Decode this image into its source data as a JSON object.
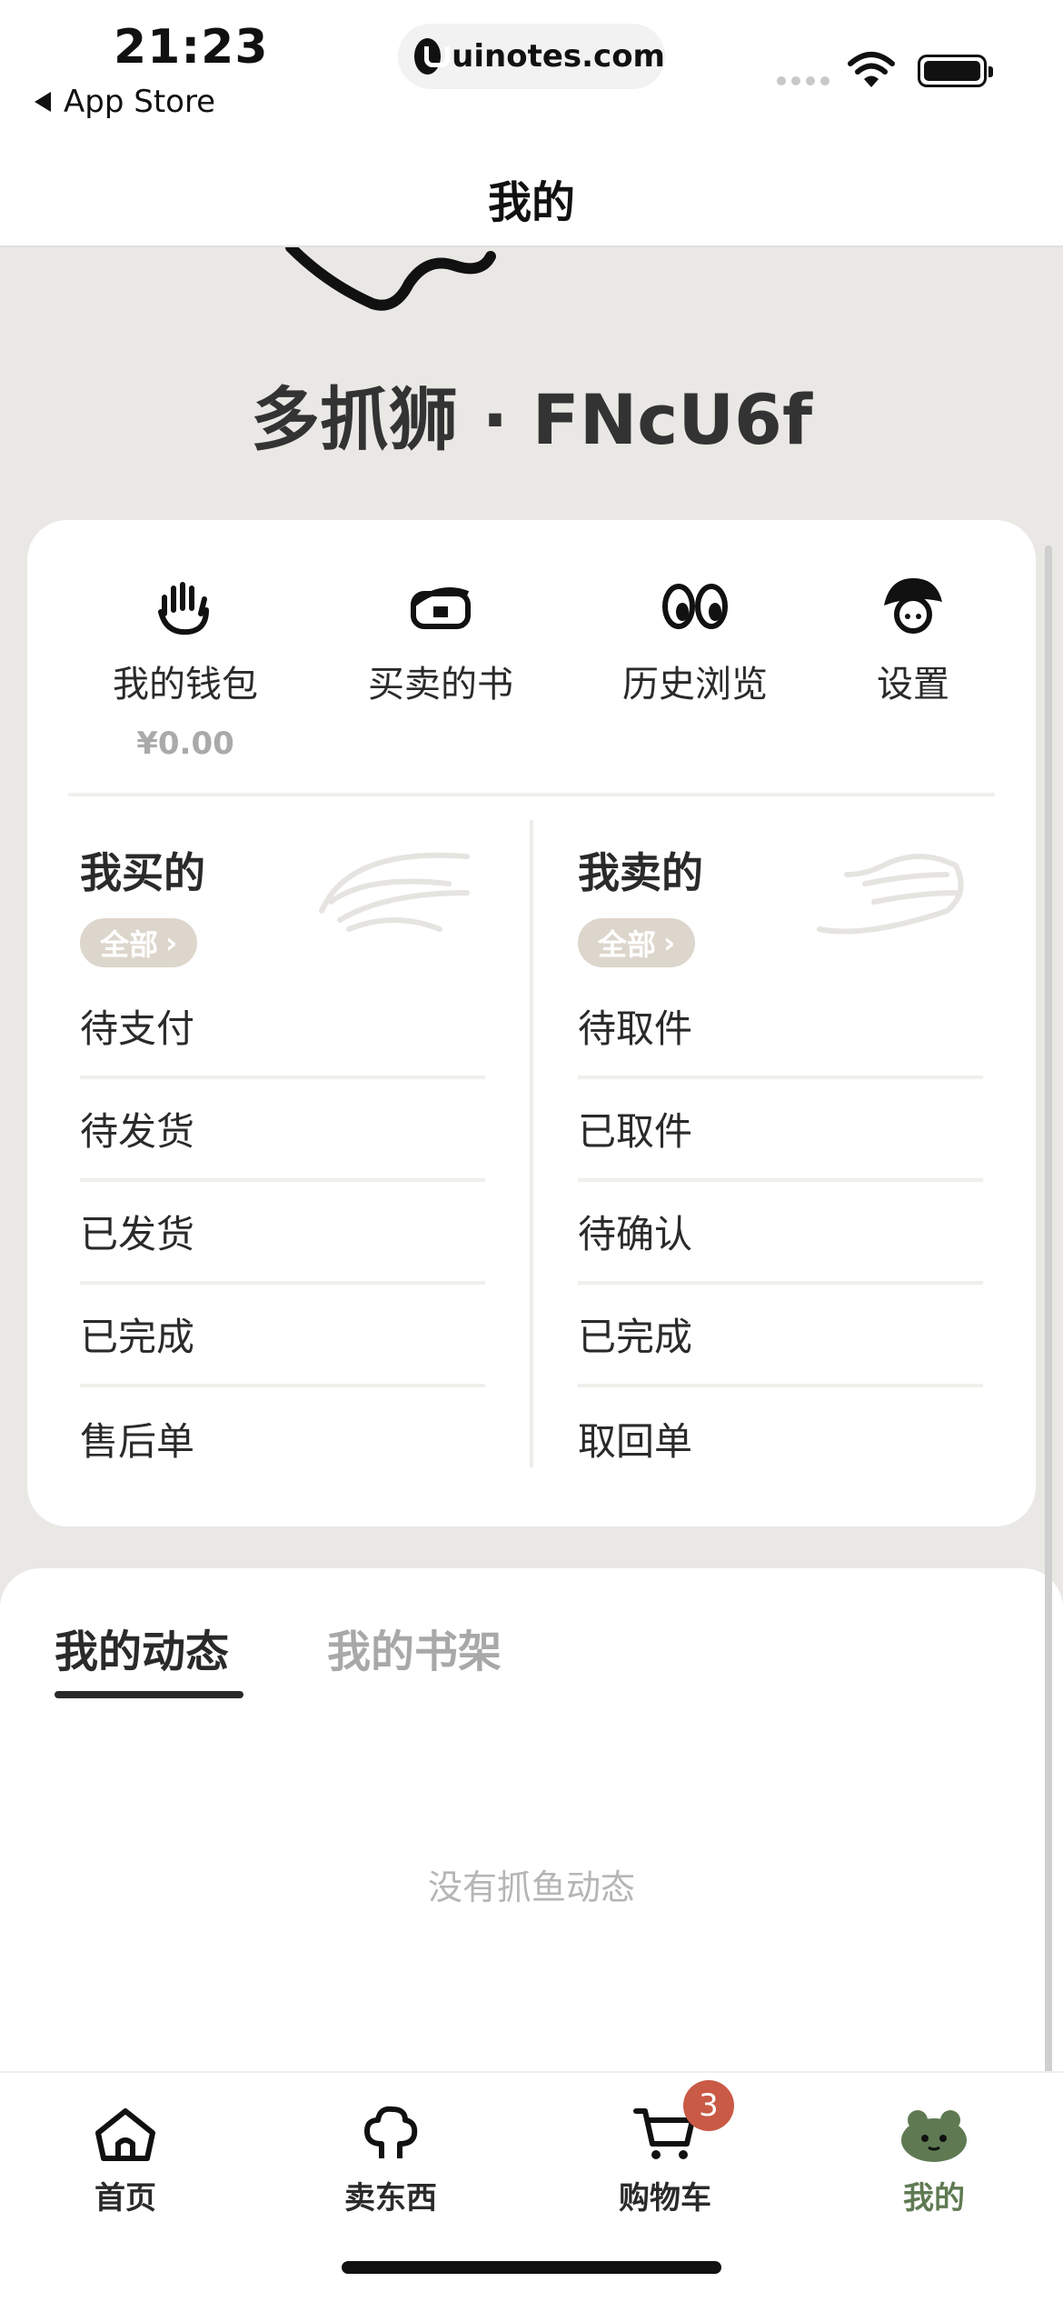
{
  "status_bar": {
    "time": "21:23",
    "back_label": "App Store",
    "url": "uinotes.com"
  },
  "nav": {
    "title": "我的"
  },
  "profile": {
    "username": "多抓狮 · FNcU6f"
  },
  "shortcuts": [
    {
      "label": "我的钱包",
      "sub": "¥0.00",
      "icon": "hand-icon"
    },
    {
      "label": "买卖的书",
      "icon": "book-icon"
    },
    {
      "label": "历史浏览",
      "icon": "eyes-icon"
    },
    {
      "label": "设置",
      "icon": "hat-avatar-icon"
    }
  ],
  "buy": {
    "title": "我买的",
    "all_label": "全部",
    "rows": [
      "待支付",
      "待发货",
      "已发货",
      "已完成",
      "售后单"
    ]
  },
  "sell": {
    "title": "我卖的",
    "all_label": "全部",
    "rows": [
      "待取件",
      "已取件",
      "待确认",
      "已完成",
      "取回单"
    ]
  },
  "feed": {
    "tabs": [
      "我的动态",
      "我的书架"
    ],
    "active_tab": 0,
    "empty_text": "没有抓鱼动态"
  },
  "tabbar": {
    "items": [
      {
        "label": "首页",
        "icon": "home-icon"
      },
      {
        "label": "卖东西",
        "icon": "tree-icon"
      },
      {
        "label": "购物车",
        "icon": "cart-icon",
        "badge": "3"
      },
      {
        "label": "我的",
        "icon": "frog-icon",
        "active": true
      }
    ]
  },
  "colors": {
    "background": "#eae8e4",
    "pill": "#ddd6cc",
    "active_tab": "#5f7a52",
    "badge": "#c95a45"
  }
}
